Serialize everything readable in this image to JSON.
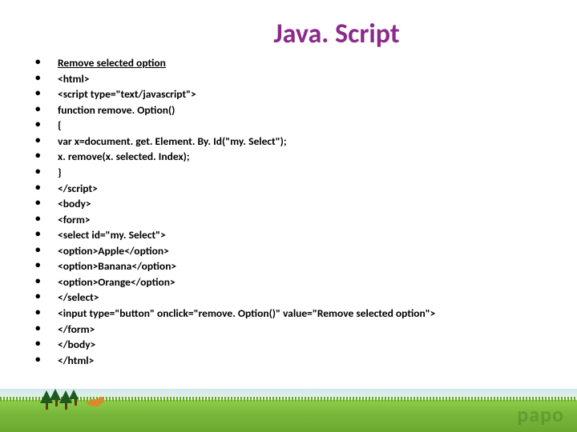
{
  "title": "Java. Script",
  "bullets": [
    {
      "text": "Remove selected option",
      "underline": true
    },
    {
      "text": "<html>"
    },
    {
      "text": "<script type=\"text/javascript\">"
    },
    {
      "text": "function remove. Option()"
    },
    {
      "text": "{"
    },
    {
      "text": "var x=document. get. Element. By. Id(\"my. Select\");"
    },
    {
      "text": "x. remove(x. selected. Index);"
    },
    {
      "text": "}"
    },
    {
      "text": "</script>"
    },
    {
      "text": "<body>"
    },
    {
      "text": "<form>"
    },
    {
      "text": "<select id=\"my. Select\">"
    },
    {
      "text": "  <option>Apple</option>"
    },
    {
      "text": "  <option>Banana</option>"
    },
    {
      "text": "  <option>Orange</option>"
    },
    {
      "text": "</select>"
    },
    {
      "text": "<input type=\"button\" onclick=\"remove. Option()\" value=\"Remove selected option\">"
    },
    {
      "text": "</form>"
    },
    {
      "text": "</body>"
    },
    {
      "text": "</html>"
    }
  ],
  "brand": "papo"
}
